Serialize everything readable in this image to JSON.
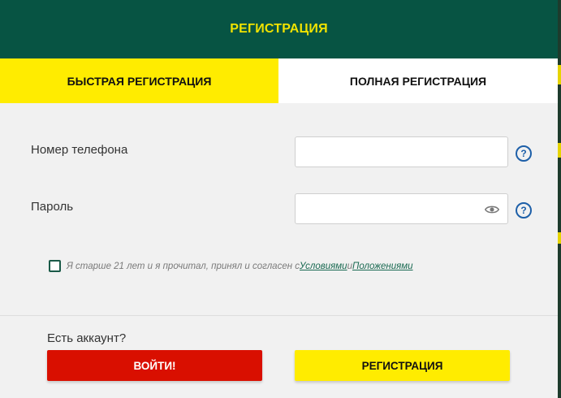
{
  "header": {
    "title": "РЕГИСТРАЦИЯ"
  },
  "tabs": [
    {
      "label": "БЫСТРАЯ РЕГИСТРАЦИЯ",
      "active": true
    },
    {
      "label": "ПОЛНАЯ РЕГИСТРАЦИЯ",
      "active": false
    }
  ],
  "form": {
    "phone": {
      "label": "Номер телефона",
      "value": "",
      "placeholder": ""
    },
    "password": {
      "label": "Пароль",
      "value": "",
      "placeholder": ""
    },
    "help_glyph": "?"
  },
  "consent": {
    "checked": false,
    "text": "Я старше 21 лет и я прочитал, принял и согласен с ",
    "link_terms": "Условиями",
    "and": "и",
    "link_conditions": "Положениями"
  },
  "footer": {
    "has_account": "Есть аккаунт?",
    "login_button": "ВОЙТИ!",
    "register_button": "РЕГИСТРАЦИЯ"
  },
  "colors": {
    "header_bg": "#075443",
    "accent_yellow": "#ffec00",
    "login_red": "#d90f00",
    "link_green": "#1a6a52",
    "help_blue": "#1d5fa8"
  },
  "icons": {
    "phone_help": "help-circle-icon",
    "password_help": "help-circle-icon",
    "password_toggle": "eye-icon"
  }
}
